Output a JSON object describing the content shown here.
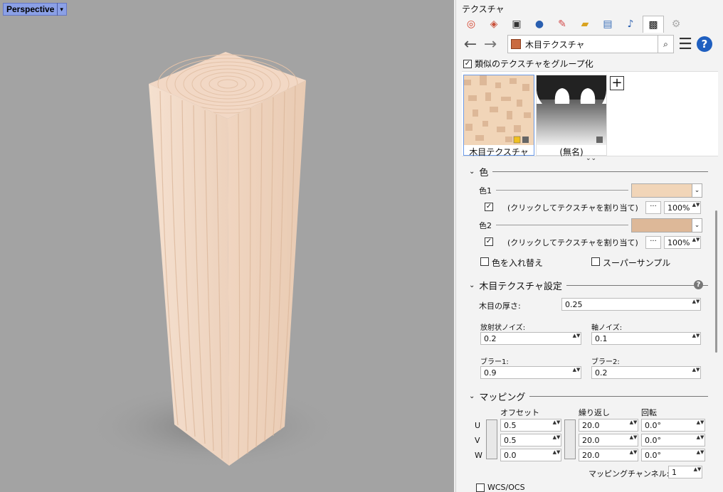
{
  "viewport": {
    "label": "Perspective",
    "dropdown_glyph": "▾"
  },
  "panel": {
    "title": "テクスチャ",
    "tabs": [
      {
        "icon": "color-wheel-icon",
        "glyph": "◎"
      },
      {
        "icon": "material-icon",
        "glyph": "◈"
      },
      {
        "icon": "display-icon",
        "glyph": "▣"
      },
      {
        "icon": "environment-icon",
        "glyph": "●"
      },
      {
        "icon": "paint-icon",
        "glyph": "✎"
      },
      {
        "icon": "folder-icon",
        "glyph": "▰"
      },
      {
        "icon": "image-icon",
        "glyph": "▤"
      },
      {
        "icon": "bell-icon",
        "glyph": "♪"
      },
      {
        "icon": "texture-icon",
        "glyph": "▩",
        "active": true
      },
      {
        "icon": "gear-icon",
        "glyph": "⚙"
      }
    ],
    "nav": {
      "back": "←",
      "forward": "→",
      "menu": "☰",
      "help": "?",
      "search": "⌕"
    },
    "current_texture": "木目テクスチャ",
    "group_similar": {
      "label": "類似のテクスチャをグループ化",
      "checked": true,
      "mark": "✓"
    },
    "thumbnails": [
      {
        "caption": "木目テクスチャ",
        "selected": true
      },
      {
        "caption": "(無名)",
        "selected": false
      }
    ],
    "add_glyph": "+",
    "collapse_glyph": "⌄⌄"
  },
  "color_section": {
    "title": "色",
    "color1": {
      "label": "色1",
      "swatch": "#f1d5b8",
      "assign": "(クリックしてテクスチャを割り当て)",
      "amount": "100%",
      "checked": true
    },
    "color2": {
      "label": "色2",
      "swatch": "#ddb898",
      "assign": "(クリックしてテクスチャを割り当て)",
      "amount": "100%",
      "checked": true
    },
    "swap": {
      "label": "色を入れ替え",
      "checked": false
    },
    "supersample": {
      "label": "スーパーサンプル",
      "checked": false
    },
    "dots": "···",
    "check_mark": "✓",
    "arrow": "⌄"
  },
  "wood_section": {
    "title": "木目テクスチャ設定",
    "grain_thickness": {
      "label": "木目の厚さ:",
      "value": "0.25"
    },
    "radial_noise": {
      "label": "放射状ノイズ:",
      "value": "0.2"
    },
    "axial_noise": {
      "label": "軸ノイズ:",
      "value": "0.1"
    },
    "blur1": {
      "label": "ブラー1:",
      "value": "0.9"
    },
    "blur2": {
      "label": "ブラー2:",
      "value": "0.2"
    },
    "help": "?"
  },
  "mapping_section": {
    "title": "マッピング",
    "col_offset": "オフセット",
    "col_repeat": "繰り返し",
    "col_rotation": "回転",
    "rows": [
      {
        "axis": "U",
        "offset": "0.5",
        "repeat": "20.0",
        "rotation": "0.0°"
      },
      {
        "axis": "V",
        "offset": "0.5",
        "repeat": "20.0",
        "rotation": "0.0°"
      },
      {
        "axis": "W",
        "offset": "0.0",
        "repeat": "20.0",
        "rotation": "0.0°"
      }
    ],
    "channel_label": "マッピングチャンネル:",
    "channel_value": "1",
    "wcs": {
      "label": "WCS/OCS",
      "checked": false
    }
  },
  "spin_glyph": "▲▼",
  "chevron": "⌄"
}
